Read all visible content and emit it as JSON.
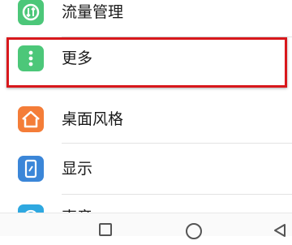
{
  "settings_list": {
    "items": [
      {
        "label": "流量管理",
        "icon": "data-usage-icon",
        "color": "#4cc779"
      },
      {
        "label": "更多",
        "icon": "more-vertical-icon",
        "color": "#4cc779"
      },
      {
        "label": "桌面风格",
        "icon": "home-style-icon",
        "color": "#f47d38"
      },
      {
        "label": "显示",
        "icon": "display-icon",
        "color": "#3b86d8"
      },
      {
        "label": "声音",
        "icon": "sound-icon",
        "color": "#2ea8e0"
      }
    ]
  },
  "highlight": {
    "target": "更多",
    "color": "#d8181c"
  },
  "navbar": {
    "buttons": [
      "recent-apps",
      "home",
      "back"
    ]
  }
}
